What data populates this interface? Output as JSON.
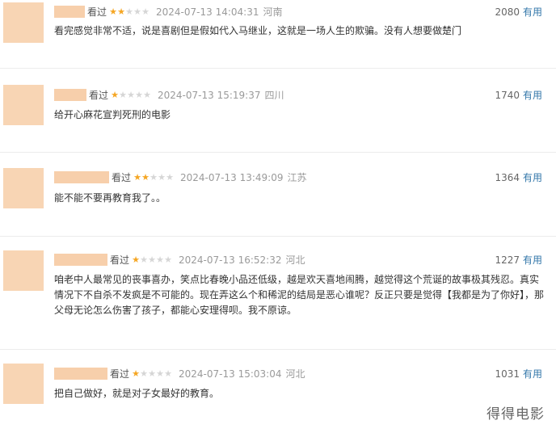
{
  "reviews": [
    {
      "seen": "看过",
      "rating": 2,
      "time": "2024-07-13 14:04:31",
      "location": "河南",
      "votes": "2080",
      "useful_label": "有用",
      "content": "看完感觉非常不适，说是喜剧但是假如代入马继业，这就是一场人生的欺骗。没有人想要做楚门"
    },
    {
      "seen": "看过",
      "rating": 1,
      "time": "2024-07-13 15:19:37",
      "location": "四川",
      "votes": "1740",
      "useful_label": "有用",
      "content": "给开心麻花宣判死刑的电影"
    },
    {
      "seen": "看过",
      "rating": 2,
      "time": "2024-07-13 13:49:09",
      "location": "江苏",
      "votes": "1364",
      "useful_label": "有用",
      "content": "能不能不要再教育我了。。"
    },
    {
      "seen": "看过",
      "rating": 1,
      "time": "2024-07-13 16:52:32",
      "location": "河北",
      "votes": "1227",
      "useful_label": "有用",
      "content": "咱老中人最常见的丧事喜办，笑点比春晚小品还低级，越是欢天喜地闹腾，越觉得这个荒诞的故事极其残忍。真实情况下不自杀不发疯是不可能的。现在弄这么个和稀泥的结局是恶心谁呢？反正只要是觉得【我都是为了你好】，那父母无论怎么伤害了孩子，都能心安理得呗。我不原谅。"
    },
    {
      "seen": "看过",
      "rating": 1,
      "time": "2024-07-13 15:03:04",
      "location": "河北",
      "votes": "1031",
      "useful_label": "有用",
      "content": "把自己做好，就是对子女最好的教育。"
    }
  ],
  "watermark": "得得电影"
}
